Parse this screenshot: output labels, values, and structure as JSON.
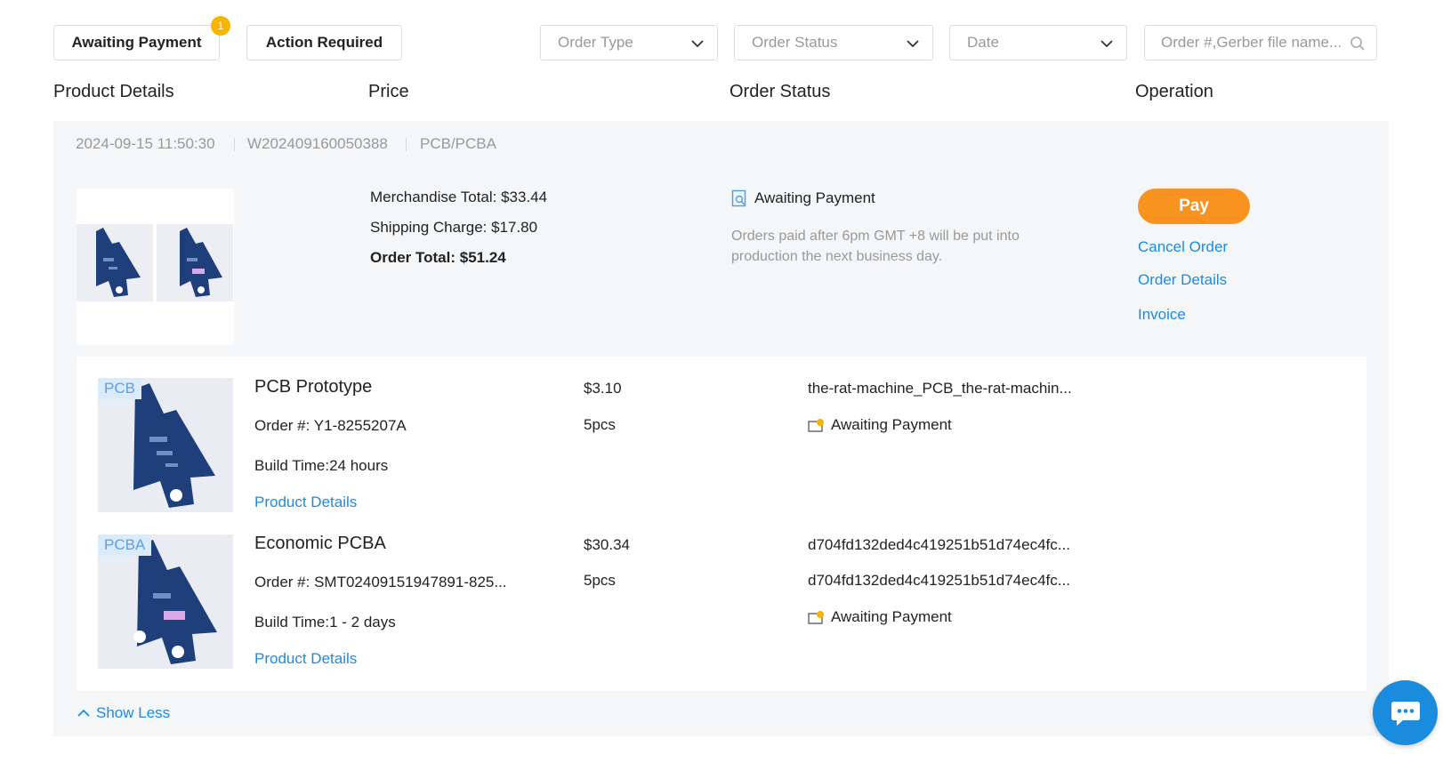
{
  "tabs": [
    {
      "label": "Awaiting Payment",
      "badge": "1"
    },
    {
      "label": "Action Required"
    }
  ],
  "filters": {
    "order_type": "Order Type",
    "order_status": "Order Status",
    "date": "Date",
    "search_placeholder": "Order #,Gerber file name..."
  },
  "columns": [
    "Product Details",
    "Price",
    "Order Status",
    "Operation"
  ],
  "order": {
    "datetime": "2024-09-15 11:50:30",
    "number": "W202409160050388",
    "category": "PCB/PCBA",
    "merchandise_total": "Merchandise Total: $33.44",
    "shipping_charge": "Shipping Charge: $17.80",
    "order_total": "Order Total: $51.24",
    "status": "Awaiting Payment",
    "status_note": "Orders paid after 6pm GMT +8 will be put into production the next business day.",
    "operations": {
      "pay": "Pay",
      "cancel": "Cancel Order",
      "details": "Order Details",
      "invoice": "Invoice"
    }
  },
  "products": [
    {
      "tag": "PCB",
      "name": "PCB Prototype",
      "order_no": "Order #: Y1-8255207A",
      "build_time": "Build Time:24 hours",
      "link": "Product Details",
      "price": "$3.10",
      "qty": "5pcs",
      "file": "the-rat-machine_PCB_the-rat-machin...",
      "status": "Awaiting Payment"
    },
    {
      "tag": "PCBA",
      "name": "Economic PCBA",
      "order_no": "Order #: SMT02409151947891-825...",
      "build_time": "Build Time:1 - 2 days",
      "link": "Product Details",
      "price": "$30.34",
      "qty": "5pcs",
      "file": "d704fd132ded4c419251b51d74ec4fc...",
      "file2": "d704fd132ded4c419251b51d74ec4fc...",
      "status": "Awaiting Payment"
    }
  ],
  "show_less": "Show Less",
  "colors": {
    "accent_orange": "#f7931e",
    "link_blue": "#1a8cde",
    "badge_yellow": "#f7b500",
    "board_navy": "#1f3f7a"
  },
  "icons": {
    "chevron": "chevron-down-icon",
    "search": "search-icon",
    "status": "document-search-icon",
    "wallet": "wallet-icon",
    "chat": "chat-bubble-icon"
  }
}
